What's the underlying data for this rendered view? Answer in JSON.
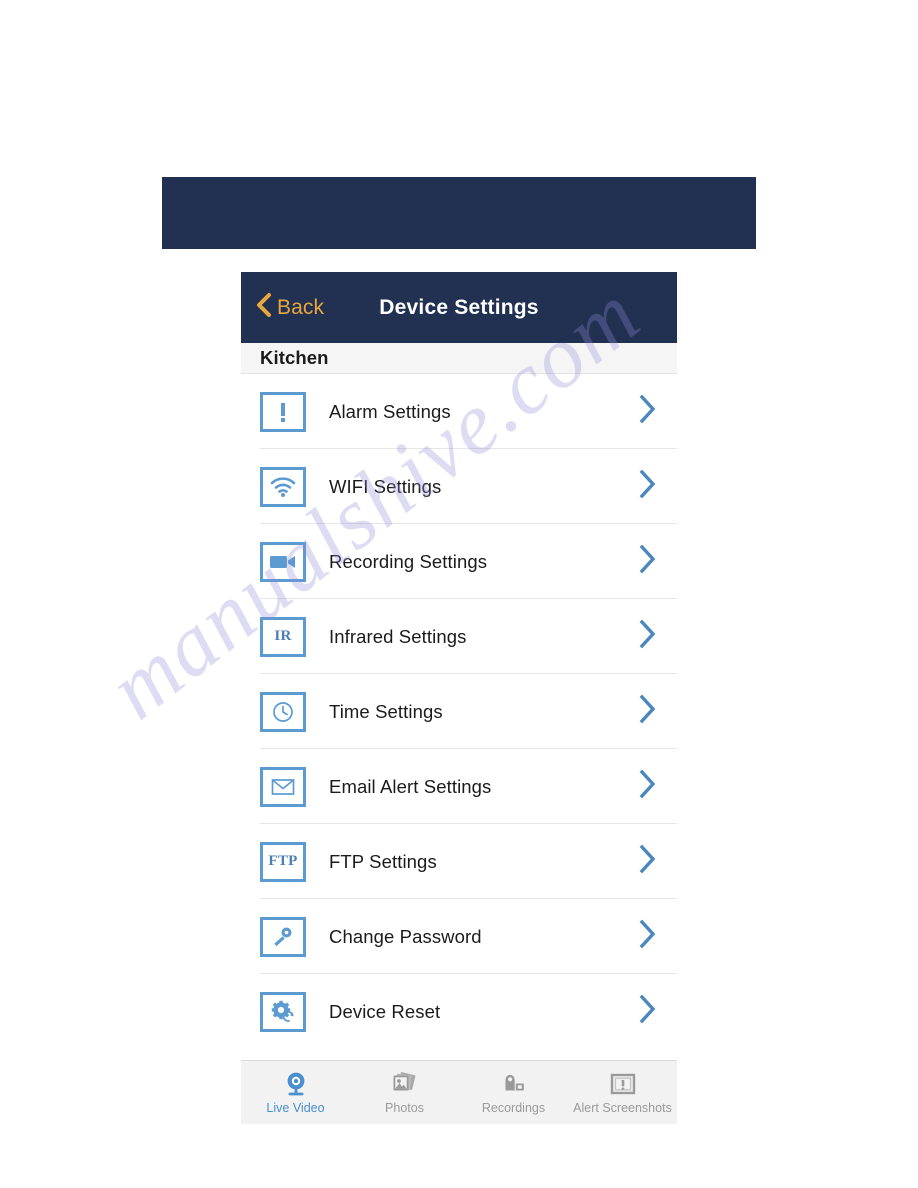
{
  "banner": {
    "color": "#223152"
  },
  "nav": {
    "back_label": "Back",
    "back_icon": "chevron-left-icon",
    "title": "Device Settings",
    "background_color": "#223152",
    "back_color": "#E9A63C"
  },
  "section": {
    "label": "Kitchen"
  },
  "settings": {
    "accent_color": "#5C9BD1",
    "chevron_color": "#4A87BE",
    "items": [
      {
        "label": "Alarm Settings",
        "icon": "alert-exclamation-icon"
      },
      {
        "label": "WIFI Settings",
        "icon": "wifi-icon"
      },
      {
        "label": "Recording Settings",
        "icon": "video-camera-icon"
      },
      {
        "label": "Infrared Settings",
        "icon": "ir-text-icon",
        "icon_text": "IR"
      },
      {
        "label": "Time Settings",
        "icon": "clock-icon"
      },
      {
        "label": "Email Alert Settings",
        "icon": "envelope-icon"
      },
      {
        "label": "FTP Settings",
        "icon": "ftp-text-icon",
        "icon_text": "FTP"
      },
      {
        "label": "Change Password",
        "icon": "key-icon"
      },
      {
        "label": "Device Reset",
        "icon": "gear-reset-icon"
      }
    ]
  },
  "tabs": {
    "active_color": "#4a8fd0",
    "inactive_color": "#9a9a9a",
    "items": [
      {
        "label": "Live Video",
        "icon": "webcam-icon",
        "active": true
      },
      {
        "label": "Photos",
        "icon": "photo-stack-icon",
        "active": false
      },
      {
        "label": "Recordings",
        "icon": "camcorder-icon",
        "active": false
      },
      {
        "label": "Alert Screenshots",
        "icon": "framed-alert-icon",
        "active": false
      }
    ]
  },
  "watermark": {
    "text": "manualshive.com"
  }
}
